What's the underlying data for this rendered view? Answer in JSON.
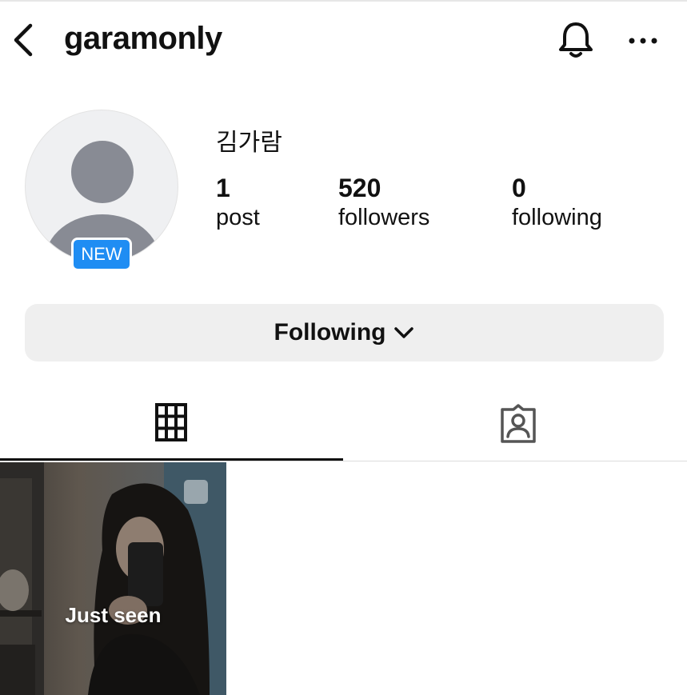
{
  "header": {
    "username": "garamonly",
    "back_icon": "chevron-left-icon",
    "bell_icon": "bell-icon",
    "more_icon": "more-horizontal-icon"
  },
  "profile": {
    "full_name": "김가람",
    "badge": "NEW",
    "stats": [
      {
        "value": "1",
        "label": "post"
      },
      {
        "value": "520",
        "label": "followers"
      },
      {
        "value": "0",
        "label": "following"
      }
    ]
  },
  "follow_button": {
    "label": "Following",
    "icon": "chevron-down-icon"
  },
  "tabs": [
    {
      "icon": "grid-icon",
      "active": true
    },
    {
      "icon": "tagged-person-icon",
      "active": false
    }
  ],
  "posts": [
    {
      "caption": "Just seen",
      "icon": "multi-post-icon"
    }
  ],
  "colors": {
    "badge": "#1f8df3",
    "button_bg": "#efefef",
    "avatar_bg": "#eff0f2",
    "avatar_figure": "#888b94"
  }
}
